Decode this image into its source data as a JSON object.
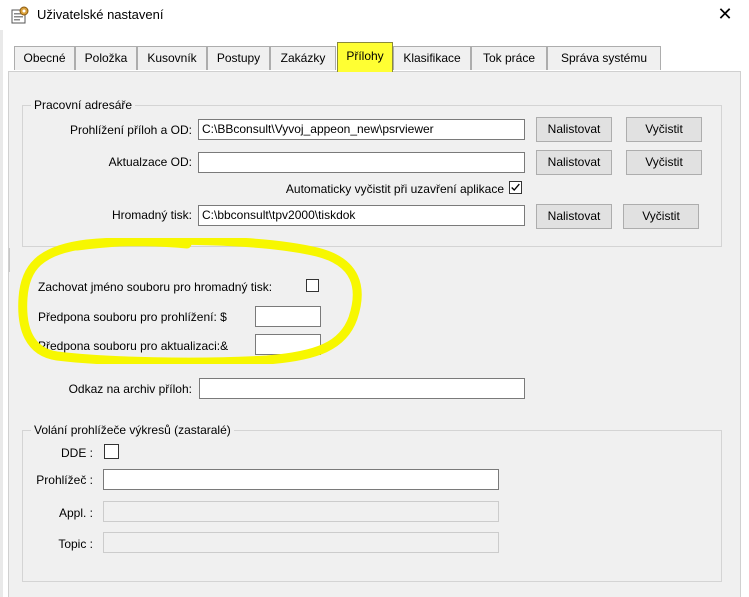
{
  "window": {
    "title": "Uživatelské nastavení",
    "close_glyph": "✕",
    "icon": "settings-app-icon"
  },
  "tabs": [
    {
      "label": "Obecné"
    },
    {
      "label": "Položka"
    },
    {
      "label": "Kusovník"
    },
    {
      "label": "Postupy"
    },
    {
      "label": "Zakázky"
    },
    {
      "label": "Přílohy",
      "active": true
    },
    {
      "label": "Klasifikace"
    },
    {
      "label": "Tok práce"
    },
    {
      "label": "Správa systému"
    }
  ],
  "work_dirs": {
    "title": "Pracovní adresáře",
    "view_label": "Prohlížení příloh a OD:",
    "view_value": "C:\\BBconsult\\Vyvoj_appeon_new\\psrviewer",
    "update_label": "Aktualzace OD:",
    "update_value": "",
    "auto_clear_label": "Automaticky vyčistit  při uzavření aplikace",
    "auto_clear_checked": true,
    "bulk_label": "Hromadný tisk:",
    "bulk_value": "C:\\bbconsult\\tpv2000\\tiskdok",
    "browse_label": "Nalistovat",
    "clear_label": "Vyčistit"
  },
  "options": {
    "keep_name_label": "Zachovat jméno souboru pro hromadný tisk:",
    "keep_name_checked": false,
    "view_prefix_label": "Předpona souboru pro prohlížení: $",
    "view_prefix_value": "",
    "update_prefix_label": "Předpona souboru pro aktualizaci:&",
    "update_prefix_value": ""
  },
  "archive": {
    "label": "Odkaz na archiv příloh:",
    "value": ""
  },
  "viewer": {
    "title": "Volání prohlížeče výkresů (zastaralé)",
    "dde_label": "DDE :",
    "dde_checked": false,
    "viewer_label": "Prohlížeč :",
    "viewer_value": "",
    "appl_label": "Appl. :",
    "appl_value": "",
    "topic_label": "Topic :",
    "topic_value": ""
  },
  "colors": {
    "active_tab": "#ffff33",
    "highlight_marker": "#f7f700",
    "panel_bg": "#f0f0f0"
  }
}
